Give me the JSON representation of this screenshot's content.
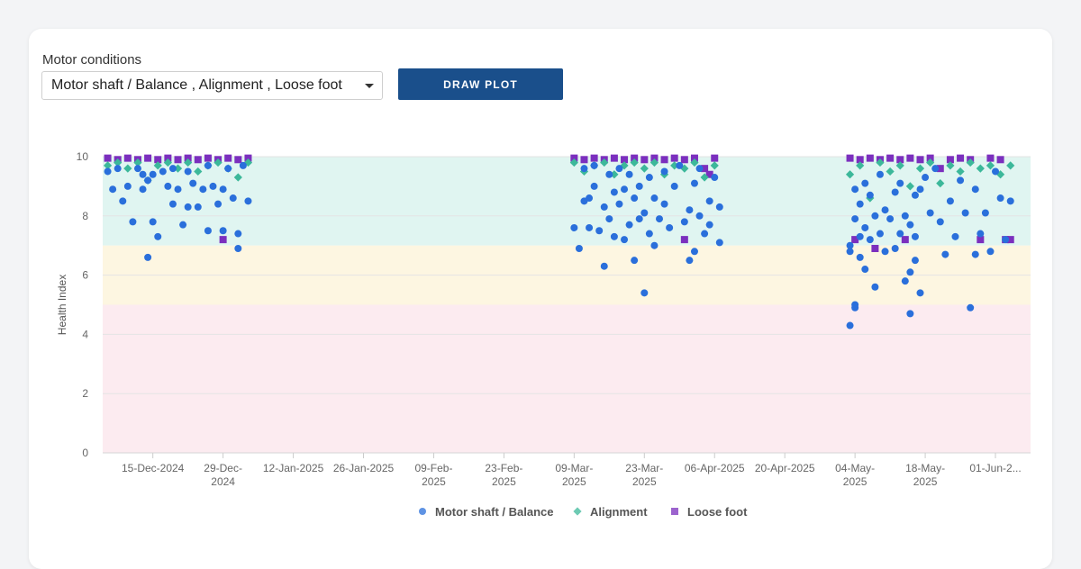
{
  "controls": {
    "label": "Motor conditions",
    "selected_value": "Motor shaft / Balance , Alignment , Loose foot",
    "draw_button": "DRAW PLOT"
  },
  "colors": {
    "background": "#f3f4f6",
    "card": "#ffffff",
    "button": "#1a4f8b",
    "zone_good": "#e0f5f1",
    "zone_warning": "#fdf6e1",
    "zone_critical": "#fcebf0",
    "motor_shaft": "#2a6fdb",
    "alignment": "#3cb89a",
    "loose_foot": "#7b2fbe"
  },
  "chart_data": {
    "type": "scatter",
    "title": "",
    "xlabel": "",
    "ylabel": "Health Index",
    "x_axis_type": "date",
    "xlim": [
      "2024-12-05",
      "2025-06-08"
    ],
    "ylim": [
      0,
      10
    ],
    "yticks": [
      0,
      2,
      4,
      6,
      8,
      10
    ],
    "grid": "horizontal",
    "legend_position": "bottom-center",
    "xticks": [
      {
        "date": "2024-12-15",
        "lines": [
          "15-Dec-2024"
        ]
      },
      {
        "date": "2024-12-29",
        "lines": [
          "29-Dec-",
          "2024"
        ]
      },
      {
        "date": "2025-01-12",
        "lines": [
          "12-Jan-2025"
        ]
      },
      {
        "date": "2025-01-26",
        "lines": [
          "26-Jan-2025"
        ]
      },
      {
        "date": "2025-02-09",
        "lines": [
          "09-Feb-",
          "2025"
        ]
      },
      {
        "date": "2025-02-23",
        "lines": [
          "23-Feb-",
          "2025"
        ]
      },
      {
        "date": "2025-03-09",
        "lines": [
          "09-Mar-",
          "2025"
        ]
      },
      {
        "date": "2025-03-23",
        "lines": [
          "23-Mar-",
          "2025"
        ]
      },
      {
        "date": "2025-04-06",
        "lines": [
          "06-Apr-2025"
        ]
      },
      {
        "date": "2025-04-20",
        "lines": [
          "20-Apr-2025"
        ]
      },
      {
        "date": "2025-05-04",
        "lines": [
          "04-May-",
          "2025"
        ]
      },
      {
        "date": "2025-05-18",
        "lines": [
          "18-May-",
          "2025"
        ]
      },
      {
        "date": "2025-06-01",
        "lines": [
          "01-Jun-2..."
        ]
      }
    ],
    "zones": [
      {
        "from": 7,
        "to": 10,
        "color": "#e0f5f1"
      },
      {
        "from": 5,
        "to": 7,
        "color": "#fdf6e1"
      },
      {
        "from": 0,
        "to": 5,
        "color": "#fcebf0"
      }
    ],
    "series": [
      {
        "name": "Motor shaft / Balance",
        "marker": "circle",
        "color": "#2a6fdb",
        "points": [
          [
            "2024-12-06",
            9.5
          ],
          [
            "2024-12-07",
            8.9
          ],
          [
            "2024-12-08",
            9.6
          ],
          [
            "2024-12-09",
            8.5
          ],
          [
            "2024-12-10",
            9.0
          ],
          [
            "2024-12-11",
            7.8
          ],
          [
            "2024-12-12",
            9.6
          ],
          [
            "2024-12-13",
            8.9
          ],
          [
            "2024-12-13",
            9.4
          ],
          [
            "2024-12-14",
            6.6
          ],
          [
            "2024-12-14",
            9.2
          ],
          [
            "2024-12-15",
            7.8
          ],
          [
            "2024-12-15",
            9.4
          ],
          [
            "2024-12-16",
            7.3
          ],
          [
            "2024-12-17",
            9.5
          ],
          [
            "2024-12-18",
            9.0
          ],
          [
            "2024-12-19",
            8.4
          ],
          [
            "2024-12-19",
            9.6
          ],
          [
            "2024-12-20",
            8.9
          ],
          [
            "2024-12-21",
            7.7
          ],
          [
            "2024-12-22",
            8.3
          ],
          [
            "2024-12-22",
            9.5
          ],
          [
            "2024-12-23",
            9.1
          ],
          [
            "2024-12-24",
            8.3
          ],
          [
            "2024-12-25",
            8.9
          ],
          [
            "2024-12-26",
            7.5
          ],
          [
            "2024-12-26",
            9.7
          ],
          [
            "2024-12-27",
            9.0
          ],
          [
            "2024-12-28",
            8.4
          ],
          [
            "2024-12-29",
            8.9
          ],
          [
            "2024-12-29",
            7.5
          ],
          [
            "2024-12-30",
            9.6
          ],
          [
            "2024-12-31",
            8.6
          ],
          [
            "2025-01-01",
            7.4
          ],
          [
            "2025-01-01",
            6.9
          ],
          [
            "2025-01-02",
            9.7
          ],
          [
            "2025-01-03",
            8.5
          ],
          [
            "2025-03-09",
            7.6
          ],
          [
            "2025-03-10",
            6.9
          ],
          [
            "2025-03-11",
            8.5
          ],
          [
            "2025-03-11",
            9.6
          ],
          [
            "2025-03-12",
            7.6
          ],
          [
            "2025-03-12",
            8.6
          ],
          [
            "2025-03-13",
            9.0
          ],
          [
            "2025-03-13",
            9.7
          ],
          [
            "2025-03-14",
            7.5
          ],
          [
            "2025-03-15",
            8.3
          ],
          [
            "2025-03-15",
            6.3
          ],
          [
            "2025-03-16",
            9.4
          ],
          [
            "2025-03-16",
            7.9
          ],
          [
            "2025-03-17",
            8.8
          ],
          [
            "2025-03-17",
            7.3
          ],
          [
            "2025-03-18",
            8.4
          ],
          [
            "2025-03-18",
            9.6
          ],
          [
            "2025-03-19",
            7.2
          ],
          [
            "2025-03-19",
            8.9
          ],
          [
            "2025-03-20",
            7.7
          ],
          [
            "2025-03-20",
            9.4
          ],
          [
            "2025-03-21",
            8.6
          ],
          [
            "2025-03-21",
            6.5
          ],
          [
            "2025-03-22",
            7.9
          ],
          [
            "2025-03-22",
            9.0
          ],
          [
            "2025-03-23",
            5.4
          ],
          [
            "2025-03-23",
            8.1
          ],
          [
            "2025-03-24",
            7.4
          ],
          [
            "2025-03-24",
            9.3
          ],
          [
            "2025-03-25",
            7.0
          ],
          [
            "2025-03-25",
            8.6
          ],
          [
            "2025-03-26",
            7.9
          ],
          [
            "2025-03-27",
            9.5
          ],
          [
            "2025-03-27",
            8.4
          ],
          [
            "2025-03-28",
            7.6
          ],
          [
            "2025-03-29",
            9.0
          ],
          [
            "2025-03-30",
            9.7
          ],
          [
            "2025-03-31",
            7.8
          ],
          [
            "2025-04-01",
            8.2
          ],
          [
            "2025-04-01",
            6.5
          ],
          [
            "2025-04-02",
            6.8
          ],
          [
            "2025-04-02",
            9.1
          ],
          [
            "2025-04-03",
            8.0
          ],
          [
            "2025-04-03",
            9.6
          ],
          [
            "2025-04-04",
            7.4
          ],
          [
            "2025-04-05",
            8.5
          ],
          [
            "2025-04-05",
            7.7
          ],
          [
            "2025-04-06",
            9.3
          ],
          [
            "2025-04-07",
            7.1
          ],
          [
            "2025-04-07",
            8.3
          ],
          [
            "2025-05-03",
            7.0
          ],
          [
            "2025-05-03",
            6.8
          ],
          [
            "2025-05-03",
            4.3
          ],
          [
            "2025-05-04",
            5.0
          ],
          [
            "2025-05-04",
            4.9
          ],
          [
            "2025-05-04",
            8.9
          ],
          [
            "2025-05-04",
            7.9
          ],
          [
            "2025-05-05",
            7.3
          ],
          [
            "2025-05-05",
            6.6
          ],
          [
            "2025-05-05",
            8.4
          ],
          [
            "2025-05-06",
            6.2
          ],
          [
            "2025-05-06",
            7.6
          ],
          [
            "2025-05-06",
            9.1
          ],
          [
            "2025-05-07",
            7.2
          ],
          [
            "2025-05-07",
            8.7
          ],
          [
            "2025-05-08",
            5.6
          ],
          [
            "2025-05-08",
            8.0
          ],
          [
            "2025-05-09",
            7.4
          ],
          [
            "2025-05-09",
            9.4
          ],
          [
            "2025-05-10",
            6.8
          ],
          [
            "2025-05-10",
            8.2
          ],
          [
            "2025-05-11",
            7.9
          ],
          [
            "2025-05-12",
            8.8
          ],
          [
            "2025-05-12",
            6.9
          ],
          [
            "2025-05-13",
            7.4
          ],
          [
            "2025-05-13",
            9.1
          ],
          [
            "2025-05-14",
            8.0
          ],
          [
            "2025-05-14",
            5.8
          ],
          [
            "2025-05-15",
            7.7
          ],
          [
            "2025-05-15",
            6.1
          ],
          [
            "2025-05-15",
            4.7
          ],
          [
            "2025-05-16",
            8.7
          ],
          [
            "2025-05-16",
            6.5
          ],
          [
            "2025-05-16",
            7.3
          ],
          [
            "2025-05-17",
            5.4
          ],
          [
            "2025-05-17",
            8.9
          ],
          [
            "2025-05-18",
            9.3
          ],
          [
            "2025-05-19",
            8.1
          ],
          [
            "2025-05-20",
            9.6
          ],
          [
            "2025-05-21",
            7.8
          ],
          [
            "2025-05-22",
            6.7
          ],
          [
            "2025-05-23",
            8.5
          ],
          [
            "2025-05-24",
            7.3
          ],
          [
            "2025-05-25",
            9.2
          ],
          [
            "2025-05-26",
            8.1
          ],
          [
            "2025-05-27",
            4.9
          ],
          [
            "2025-05-28",
            6.7
          ],
          [
            "2025-05-28",
            8.9
          ],
          [
            "2025-05-29",
            7.4
          ],
          [
            "2025-05-30",
            8.1
          ],
          [
            "2025-05-31",
            6.8
          ],
          [
            "2025-06-01",
            9.5
          ],
          [
            "2025-06-02",
            8.6
          ],
          [
            "2025-06-03",
            7.2
          ],
          [
            "2025-06-04",
            8.5
          ]
        ]
      },
      {
        "name": "Alignment",
        "marker": "diamond",
        "color": "#3cb89a",
        "points": [
          [
            "2024-12-06",
            9.7
          ],
          [
            "2024-12-08",
            9.8
          ],
          [
            "2024-12-10",
            9.6
          ],
          [
            "2024-12-12",
            9.8
          ],
          [
            "2024-12-14",
            9.2
          ],
          [
            "2024-12-16",
            9.7
          ],
          [
            "2024-12-18",
            9.8
          ],
          [
            "2024-12-20",
            9.6
          ],
          [
            "2024-12-22",
            9.8
          ],
          [
            "2024-12-24",
            9.5
          ],
          [
            "2024-12-26",
            9.7
          ],
          [
            "2024-12-28",
            9.8
          ],
          [
            "2024-12-30",
            9.6
          ],
          [
            "2025-01-01",
            9.3
          ],
          [
            "2025-01-03",
            9.8
          ],
          [
            "2025-03-09",
            9.8
          ],
          [
            "2025-03-11",
            9.5
          ],
          [
            "2025-03-13",
            9.7
          ],
          [
            "2025-03-15",
            9.8
          ],
          [
            "2025-03-17",
            9.4
          ],
          [
            "2025-03-19",
            9.7
          ],
          [
            "2025-03-21",
            9.8
          ],
          [
            "2025-03-23",
            9.6
          ],
          [
            "2025-03-25",
            9.8
          ],
          [
            "2025-03-27",
            9.4
          ],
          [
            "2025-03-29",
            9.7
          ],
          [
            "2025-03-31",
            9.6
          ],
          [
            "2025-04-02",
            9.8
          ],
          [
            "2025-04-04",
            9.3
          ],
          [
            "2025-04-06",
            9.7
          ],
          [
            "2025-05-03",
            9.4
          ],
          [
            "2025-05-05",
            9.7
          ],
          [
            "2025-05-07",
            8.6
          ],
          [
            "2025-05-09",
            9.8
          ],
          [
            "2025-05-11",
            9.5
          ],
          [
            "2025-05-13",
            9.7
          ],
          [
            "2025-05-15",
            9.0
          ],
          [
            "2025-05-17",
            9.6
          ],
          [
            "2025-05-19",
            9.8
          ],
          [
            "2025-05-21",
            9.1
          ],
          [
            "2025-05-23",
            9.7
          ],
          [
            "2025-05-25",
            9.5
          ],
          [
            "2025-05-27",
            9.8
          ],
          [
            "2025-05-29",
            9.6
          ],
          [
            "2025-05-31",
            9.7
          ],
          [
            "2025-06-02",
            9.4
          ],
          [
            "2025-06-04",
            9.7
          ]
        ]
      },
      {
        "name": "Loose foot",
        "marker": "square",
        "color": "#7b2fbe",
        "points": [
          [
            "2024-12-06",
            9.95
          ],
          [
            "2024-12-08",
            9.9
          ],
          [
            "2024-12-10",
            9.95
          ],
          [
            "2024-12-12",
            9.9
          ],
          [
            "2024-12-14",
            9.95
          ],
          [
            "2024-12-16",
            9.9
          ],
          [
            "2024-12-18",
            9.95
          ],
          [
            "2024-12-20",
            9.9
          ],
          [
            "2024-12-22",
            9.95
          ],
          [
            "2024-12-24",
            9.9
          ],
          [
            "2024-12-26",
            9.95
          ],
          [
            "2024-12-28",
            9.9
          ],
          [
            "2024-12-29",
            7.2
          ],
          [
            "2024-12-30",
            9.95
          ],
          [
            "2025-01-01",
            9.9
          ],
          [
            "2025-01-03",
            9.95
          ],
          [
            "2025-03-09",
            9.95
          ],
          [
            "2025-03-11",
            9.9
          ],
          [
            "2025-03-13",
            9.95
          ],
          [
            "2025-03-15",
            9.9
          ],
          [
            "2025-03-17",
            9.95
          ],
          [
            "2025-03-19",
            9.9
          ],
          [
            "2025-03-21",
            9.95
          ],
          [
            "2025-03-23",
            9.9
          ],
          [
            "2025-03-25",
            9.95
          ],
          [
            "2025-03-27",
            9.9
          ],
          [
            "2025-03-29",
            9.95
          ],
          [
            "2025-03-31",
            7.2
          ],
          [
            "2025-03-31",
            9.9
          ],
          [
            "2025-04-02",
            9.95
          ],
          [
            "2025-04-04",
            9.6
          ],
          [
            "2025-04-05",
            9.4
          ],
          [
            "2025-04-06",
            9.95
          ],
          [
            "2025-05-03",
            9.95
          ],
          [
            "2025-05-04",
            7.2
          ],
          [
            "2025-05-05",
            9.9
          ],
          [
            "2025-05-07",
            9.95
          ],
          [
            "2025-05-08",
            6.9
          ],
          [
            "2025-05-09",
            9.9
          ],
          [
            "2025-05-11",
            9.95
          ],
          [
            "2025-05-13",
            9.9
          ],
          [
            "2025-05-14",
            7.2
          ],
          [
            "2025-05-15",
            9.95
          ],
          [
            "2025-05-17",
            9.9
          ],
          [
            "2025-05-19",
            9.95
          ],
          [
            "2025-05-21",
            9.6
          ],
          [
            "2025-05-23",
            9.9
          ],
          [
            "2025-05-25",
            9.95
          ],
          [
            "2025-05-27",
            9.9
          ],
          [
            "2025-05-29",
            7.2
          ],
          [
            "2025-05-31",
            9.95
          ],
          [
            "2025-06-02",
            9.9
          ],
          [
            "2025-06-03",
            7.2
          ],
          [
            "2025-06-04",
            7.2
          ]
        ]
      }
    ]
  }
}
